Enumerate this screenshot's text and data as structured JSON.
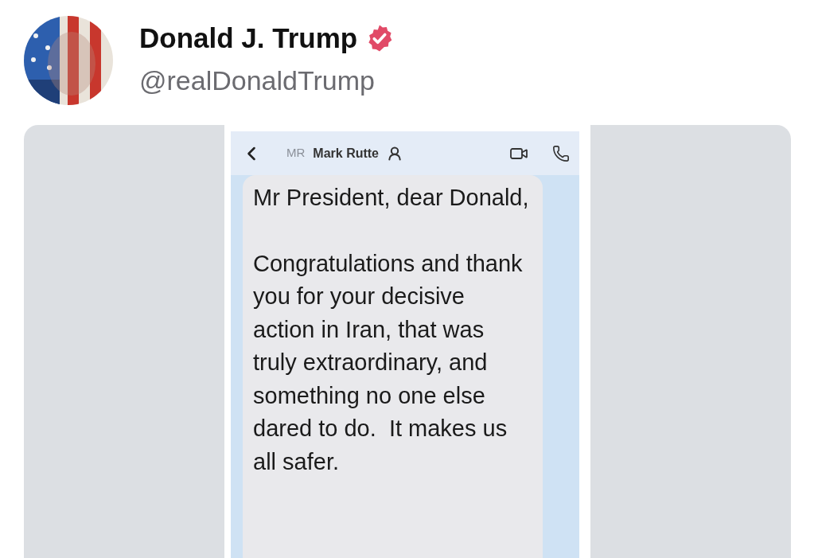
{
  "post": {
    "author_name": "Donald J. Trump",
    "verified": true,
    "handle": "@realDonaldTrump"
  },
  "media": {
    "chat": {
      "initials": "MR",
      "contact_name": "Mark Rutte",
      "message": [
        "Mr President, dear Donald,",
        "Congratulations and thank you for your decisive action in Iran, that was truly extraordinary, and something no one else dared to do.  It makes us all safer."
      ]
    }
  }
}
